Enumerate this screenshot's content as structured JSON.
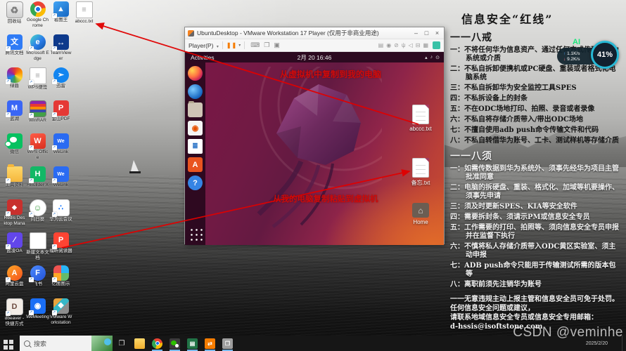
{
  "board": {
    "title": "信息安全“红线”",
    "section1": {
      "header": "一一八戒",
      "items": [
        "一：不将任何华为信息资产、通过任何方式传到非华为系统或介质",
        "二：不私自拆卸便携机或PC硬盘、重装或者格式化电脑系统",
        "三：不私自拆卸华为安全监控工具SPES",
        "四：不私拆设备上的封条",
        "五：不在ODC场地打印、拍照、录音或者录像",
        "六：不私自将存储介质带入/带出ODC场地",
        "七：不擅自使用adb push命令传输文件和代码",
        "八：不私自转借华为账号、工卡、测试样机等存储介质"
      ]
    },
    "section2": {
      "header": "一一八须",
      "items": [
        "一：如需传数据到华为系统外、须事先经华为项目主管批准同意",
        "二：电脑的拆硬盘、重装、格式化、加域等机要操作、须事先申请",
        "三：须及时更新SPES、KIA等安全软件",
        "四：需要拆封条、须请示PM或信息安全专员",
        "五：工作需要的打印、拍照等、须向信息安全专员申报并在监督下执行",
        "六：不慎将私人存储介质带入ODC黄区实验室、须主动申报",
        "七：ADB push命令只能用于传输测试所需的版本包等",
        "八：离职前须先注销华为账号"
      ]
    },
    "footer": [
      "一一无意违规主动上报主管和信息安全员可免于处罚。",
      "任何信息安全问题或建议，",
      "请联系地域信息安全专员或信息安全专用邮箱：",
      "d-hssis@isoftstone.com"
    ]
  },
  "ai_widget": {
    "label": "AI",
    "up_glyph": "↑",
    "up": "1.1K/s",
    "down_glyph": "↓",
    "down": "9.2K/s",
    "percent": "41%"
  },
  "windows_desktop": {
    "icons": [
      {
        "label": "回收站",
        "glyph": "♻"
      },
      {
        "label": "Google Chrome",
        "glyph": ""
      },
      {
        "label": "看图王",
        "glyph": "▲"
      },
      {
        "label": "abccc.txt",
        "glyph": "≡"
      },
      {
        "label": "腾讯文档",
        "glyph": "文"
      },
      {
        "label": "Microsoft Edge",
        "glyph": "e"
      },
      {
        "label": "TeamViewer",
        "glyph": "↔"
      },
      {
        "label": "绿盾",
        "glyph": ""
      },
      {
        "label": "WPS便签",
        "glyph": "≡"
      },
      {
        "label": "迅雷",
        "glyph": "➢"
      },
      {
        "label": "蓝湖",
        "glyph": "M"
      },
      {
        "label": "WinRAR",
        "glyph": ""
      },
      {
        "label": "金山PDF",
        "glyph": "P"
      },
      {
        "label": "微信",
        "glyph": ""
      },
      {
        "label": "WPS Office",
        "glyph": "W"
      },
      {
        "label": "WeLink",
        "glyph": "We"
      },
      {
        "label": "工具资料",
        "glyph": ""
      },
      {
        "label": "HBuilder X",
        "glyph": "H"
      },
      {
        "label": "WeLink",
        "glyph": "We"
      },
      {
        "label": "Redis Desktop Manager",
        "glyph": "◆"
      },
      {
        "label": "向日葵",
        "glyph": "☺"
      },
      {
        "label": "华为云会议",
        "glyph": "∴"
      },
      {
        "label": "蓝凌OA",
        "glyph": "∕"
      },
      {
        "label": "新建文本文档",
        "glyph": ""
      },
      {
        "label": "福昕阅读器",
        "glyph": "P"
      },
      {
        "label": "阿里云盘",
        "glyph": "A"
      },
      {
        "label": "飞书",
        "glyph": "F"
      },
      {
        "label": "亿图图示",
        "glyph": ""
      },
      {
        "label": "dbeaver - 快捷方式",
        "glyph": "D"
      },
      {
        "label": "WeMeeting",
        "glyph": "◉"
      },
      {
        "label": "VMware Workstation Pro",
        "glyph": "❖"
      }
    ]
  },
  "vmware": {
    "title": "UbuntuDesktop - VMware Workstation 17 Player (仅用于非商业用途)",
    "menu_player": "Player(P)",
    "menu_caret": "▾",
    "pause_glyph": "❚❚",
    "left_icons": [
      {
        "name": "keyboard-icon",
        "glyph": "⌨"
      },
      {
        "name": "fullscreen-icon",
        "glyph": "❐"
      },
      {
        "name": "unity-icon",
        "glyph": "▣"
      }
    ],
    "device_icons": [
      {
        "name": "hard-disk-icon",
        "glyph": "▤"
      },
      {
        "name": "cd-rom-icon",
        "glyph": "◉"
      },
      {
        "name": "network-adapter-icon",
        "glyph": "⊘"
      },
      {
        "name": "usb-icon",
        "glyph": "ψ"
      },
      {
        "name": "sound-icon",
        "glyph": "◁"
      },
      {
        "name": "printer-icon",
        "glyph": "⊟"
      },
      {
        "name": "display-icon",
        "glyph": "▦"
      }
    ],
    "buttons": {
      "minimize": "–",
      "maximize": "□",
      "close": "×"
    }
  },
  "ubuntu": {
    "activities_label": "Activities",
    "clock": "2月 20 16:46",
    "status_icons": [
      {
        "name": "network-icon",
        "glyph": "▴"
      },
      {
        "name": "volume-icon",
        "glyph": "♪"
      },
      {
        "name": "power-icon",
        "glyph": "⊙"
      }
    ],
    "dock": [
      "firefox",
      "thunderbird",
      "files",
      "rhythmbox",
      "libreoffice-writer",
      "ubuntu-software",
      "help",
      "app-grid"
    ],
    "dock_glyphs": {
      "rhythmbox": "◉",
      "writer": "≣",
      "software": "A",
      "help": "?"
    },
    "files": [
      {
        "name": "abccc.txt"
      },
      {
        "name": "备忘.txt"
      },
      {
        "name": "Home"
      }
    ]
  },
  "annotations": {
    "arrow1_label": "从虚拟机中复制到我的电脑",
    "arrow2_label": "从我的电脑复制粘贴到虚拟机",
    "arrow_color": "#e00000"
  },
  "taskbar": {
    "search_placeholder": "搜索",
    "date": "2025/2/20",
    "pinned": [
      "file-explorer",
      "chrome",
      "wechat",
      "excel",
      "transfer-tool",
      "remote-window"
    ]
  },
  "watermark": "CSDN @veminhe"
}
